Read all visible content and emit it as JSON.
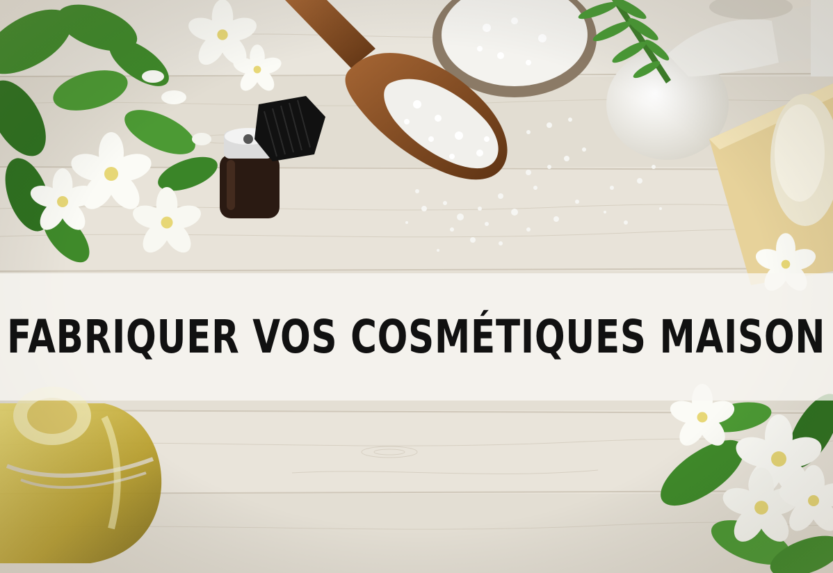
{
  "banner": {
    "headline": "FABRIQUER VOS COSMÉTIQUES MAISON"
  },
  "colors": {
    "wood_light": "#e6e1d7",
    "wood_grain": "#c9c1b2",
    "leaf_green": "#3f8a2a",
    "flower_white": "#fbfbf6",
    "flower_center": "#e7d776",
    "scoop_brown": "#8a4e22",
    "oil_gold": "#c9b43c",
    "bottle_dark": "#2a1a12",
    "headline_text": "#111111",
    "banner_overlay": "#f8f7f3"
  }
}
